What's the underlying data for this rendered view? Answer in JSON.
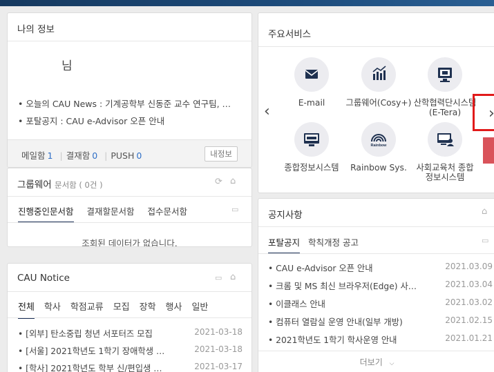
{
  "info": {
    "title": "나의 정보",
    "name_suffix": "님",
    "news_line": "• 오늘의 CAU News :  기계공학부 신동준 교수 연구팀, …",
    "portal_line": "• 포탈공지 :  CAU e-Advisor 오픈 안내",
    "mail_label": "메일함",
    "mail_count": "1",
    "approval_label": "결재함",
    "approval_count": "0",
    "push_label": "PUSH",
    "push_count": "0",
    "myinfo_button": "내정보"
  },
  "groupware": {
    "title": "그룹웨어",
    "subtitle": "문서함 ( 0건 )",
    "tabs": [
      "진행중인문서함",
      "결재할문서함",
      "접수문서함"
    ],
    "empty_text": "조회된 데이터가 없습니다."
  },
  "notice": {
    "title": "CAU Notice",
    "tabs": [
      "전체",
      "학사",
      "학점교류",
      "모집",
      "장학",
      "행사",
      "일반"
    ],
    "items": [
      {
        "text": "• [외부] 탄소중립 청년 서포터즈 모집",
        "date": "2021-03-18"
      },
      {
        "text": "• [서울] 2021학년도 1학기 장애학생 …",
        "date": "2021-03-18"
      },
      {
        "text": "• [학사] 2021학년도 학부 신/편입생 …",
        "date": "2021-03-17"
      }
    ]
  },
  "services": {
    "title": "주요서비스",
    "items": [
      {
        "label": "E-mail",
        "icon": "mail-icon"
      },
      {
        "label": "그룹웨어(Cosy+)",
        "icon": "chart-icon"
      },
      {
        "label": "산학협력단시스템\n(E-Tera)",
        "icon": "book-monitor-icon"
      },
      {
        "label": "종합정보시스템",
        "icon": "monitor-icon"
      },
      {
        "label": "Rainbow Sys.",
        "icon": "rainbow-icon",
        "icon_text": "Rainbow"
      },
      {
        "label": "사회교육처 종합\n정보시스템",
        "icon": "presenter-monitor-icon"
      }
    ]
  },
  "announcements": {
    "title": "공지사항",
    "tabs": [
      "포탈공지",
      "학칙개정 공고"
    ],
    "items": [
      {
        "text": "• CAU e-Advisor 오픈 안내",
        "date": "2021.03.09"
      },
      {
        "text": "• 크롬 및 MS 최신 브라우저(Edge) 사…",
        "date": "2021.03.04"
      },
      {
        "text": "• 이클래스 안내",
        "date": "2021.03.02"
      },
      {
        "text": "• 컴퓨터 열람실 운영 안내(일부 개방)",
        "date": "2021.02.15"
      },
      {
        "text": "• 2021학년도 1학기 학사운영 안내",
        "date": "2021.01.21"
      }
    ],
    "more": "더보기"
  },
  "colors": {
    "accent": "#1b2f56",
    "link": "#2f6fc7",
    "highlight": "#e11a1a"
  }
}
